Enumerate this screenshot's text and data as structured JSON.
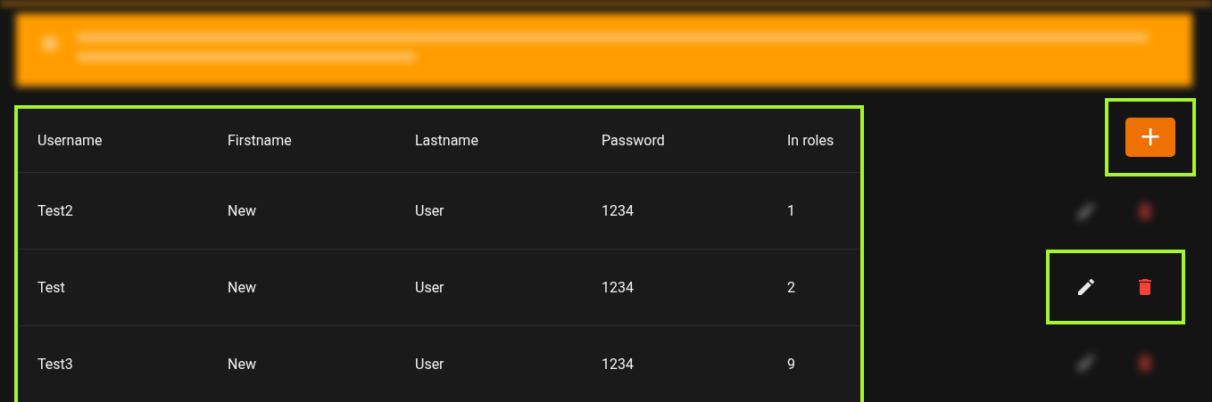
{
  "banner": {
    "kind": "blurred"
  },
  "table": {
    "highlighted": true,
    "columns": [
      "Username",
      "Firstname",
      "Lastname",
      "Password",
      "In roles"
    ],
    "rows": [
      {
        "cells": [
          "Test2",
          "New",
          "User",
          "1234",
          "1"
        ],
        "actions_in_focus": false
      },
      {
        "cells": [
          "Test",
          "New",
          "User",
          "1234",
          "2"
        ],
        "actions_in_focus": true
      },
      {
        "cells": [
          "Test3",
          "New",
          "User",
          "1234",
          "9"
        ],
        "actions_in_focus": false
      }
    ]
  },
  "add_button": {
    "label": "+",
    "highlighted": true
  }
}
